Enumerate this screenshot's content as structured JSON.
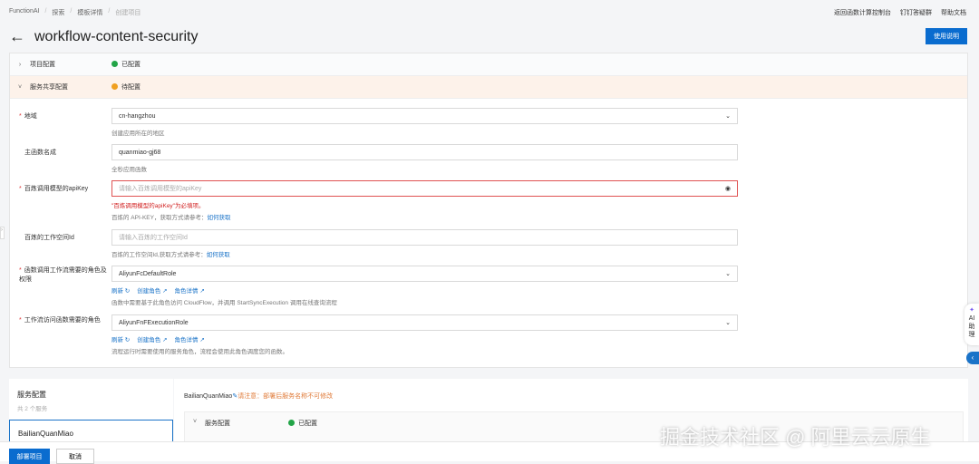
{
  "breadcrumb": [
    "FunctionAI",
    "探索",
    "模板详情",
    "创建项目"
  ],
  "top_links": [
    "返回函数计算控制台",
    "钉钉答疑群",
    "帮助文档"
  ],
  "title": "workflow-content-security",
  "usage_button": "使用说明",
  "sections": [
    {
      "label": "项目配置",
      "status": "已配置",
      "status_color": "#22a447"
    },
    {
      "label": "服务共享配置",
      "status": "待配置",
      "status_color": "#f0a020"
    }
  ],
  "fields": [
    {
      "label": "地域",
      "required": true,
      "value": "cn-hangzhou",
      "help": "创建应用所在的地区",
      "type": "select"
    },
    {
      "label": "主函数名成",
      "required": false,
      "value": "quanmiao-gj68",
      "help": "全秒应用函数"
    },
    {
      "label": "百炼调用模型的apiKey",
      "required": true,
      "placeholder": "请输入百炼调用模型的apiKey",
      "error": "\"百炼调用模型的apiKey\"为必填项。",
      "help": "百炼的 API-KEY，获取方式请参考：",
      "help_link": "如何获取"
    },
    {
      "label": "百炼的工作空间Id",
      "required": false,
      "placeholder": "请输入百炼的工作空间Id",
      "help": "百炼的工作空间Id,获取方式请参考：",
      "help_link": "如何获取"
    },
    {
      "label": "函数调用工作流需要的角色及权限",
      "required": true,
      "value": "AliyunFcDefaultRole",
      "help": "函数中需要基于此角色访问 CloudFlow，并调用 StartSyncExecution 调用在线查询流程",
      "links": [
        "刷新",
        "创建角色",
        "角色详情"
      ]
    },
    {
      "label": "工作流访问函数需要的角色",
      "required": true,
      "value": "AliyunFnFExecutionRole",
      "help": "流程运行时需要使用的服务角色，流程会使用此角色调度您的函数。",
      "links": [
        "刷新",
        "创建角色",
        "角色详情"
      ]
    }
  ],
  "service": {
    "title": "服务配置",
    "count": "共 2 个服务",
    "selected": "BailianQuanMiao",
    "name": "BailianQuanMiao",
    "notice": "请注意：部署后服务名称不可修改",
    "sub_label": "服务配置",
    "sub_status": "已配置"
  },
  "footer": {
    "deploy": "部署项目",
    "cancel": "取消"
  },
  "ai_assistant": "AI助理",
  "watermark": "掘金技术社区 @ 阿里云云原生"
}
